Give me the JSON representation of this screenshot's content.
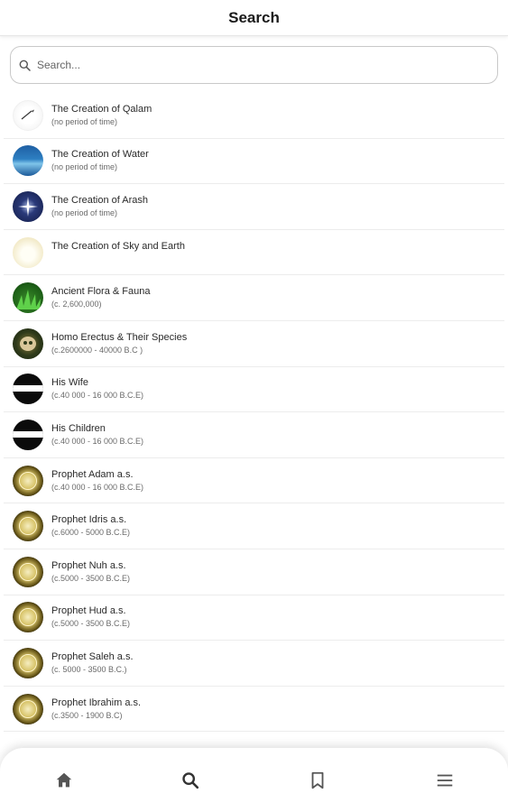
{
  "header": {
    "title": "Search"
  },
  "search": {
    "placeholder": "Search..."
  },
  "items": [
    {
      "title": "The Creation of Qalam",
      "subtitle": "(no period of time)",
      "thumb": "qalam"
    },
    {
      "title": "The Creation of Water",
      "subtitle": "(no period of time)",
      "thumb": "water"
    },
    {
      "title": "The Creation of Arash",
      "subtitle": "(no period of time)",
      "thumb": "arash"
    },
    {
      "title": "The Creation of Sky and Earth",
      "subtitle": "",
      "thumb": "sky"
    },
    {
      "title": "Ancient Flora & Fauna",
      "subtitle": "(c. 2,600,000)",
      "thumb": "flora"
    },
    {
      "title": "Homo Erectus & Their Species",
      "subtitle": "(c.2600000 - 40000 B.C )",
      "thumb": "erectus"
    },
    {
      "title": "His Wife",
      "subtitle": "(c.40 000 - 16 000 B.C.E)",
      "thumb": "wife"
    },
    {
      "title": "His Children",
      "subtitle": "(c.40 000 - 16 000 B.C.E)",
      "thumb": "children"
    },
    {
      "title": "Prophet Adam a.s.",
      "subtitle": "(c.40 000 - 16 000 B.C.E)",
      "thumb": "prophet"
    },
    {
      "title": "Prophet Idris a.s.",
      "subtitle": " (c.6000 - 5000 B.C.E)",
      "thumb": "prophet"
    },
    {
      "title": "Prophet Nuh a.s.",
      "subtitle": "(c.5000 - 3500 B.C.E)",
      "thumb": "prophet"
    },
    {
      "title": "Prophet Hud a.s.",
      "subtitle": "(c.5000 - 3500 B.C.E)",
      "thumb": "prophet"
    },
    {
      "title": "Prophet Saleh a.s.",
      "subtitle": "(c. 5000 - 3500 B.C.)",
      "thumb": "prophet"
    },
    {
      "title": "Prophet Ibrahim a.s.",
      "subtitle": "(c.3500 - 1900 B.C)",
      "thumb": "prophet"
    }
  ],
  "nav": [
    {
      "icon": "home-icon"
    },
    {
      "icon": "search-icon"
    },
    {
      "icon": "bookmark-icon"
    },
    {
      "icon": "menu-icon"
    }
  ],
  "colors": {
    "icon": "#555555",
    "active_icon": "#333333",
    "border": "#ececec"
  }
}
